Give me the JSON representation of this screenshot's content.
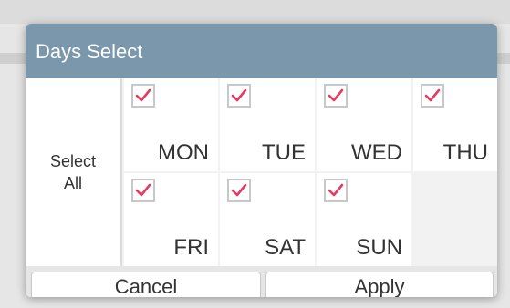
{
  "dialog": {
    "title": "Days Select",
    "select_all_label": "Select All",
    "days": [
      {
        "label": "MON",
        "checked": true
      },
      {
        "label": "TUE",
        "checked": true
      },
      {
        "label": "WED",
        "checked": true
      },
      {
        "label": "THU",
        "checked": true
      },
      {
        "label": "FRI",
        "checked": true
      },
      {
        "label": "SAT",
        "checked": true
      },
      {
        "label": "SUN",
        "checked": true
      }
    ],
    "cancel_label": "Cancel",
    "apply_label": "Apply"
  },
  "colors": {
    "header_bg": "#7b97ac",
    "check": "#e8395f"
  }
}
